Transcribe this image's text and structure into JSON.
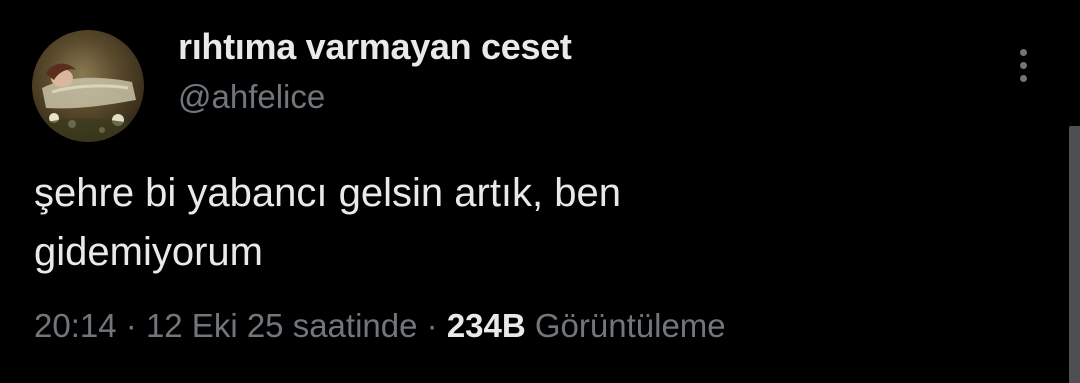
{
  "author": {
    "display_name": "rıhtıma varmayan ceset",
    "handle": "@ahfelice"
  },
  "tweet": {
    "text_line1": "şehre bi yabancı gelsin artık, ben",
    "text_line2": "gidemiyorum"
  },
  "meta": {
    "time": "20:14",
    "separator1": "·",
    "date": "12 Eki 25 saatinde",
    "separator2": "·",
    "views_count": "234B",
    "views_label": "Görüntüleme"
  },
  "icons": {
    "more": "more-vertical-icon",
    "avatar": "avatar-painting"
  },
  "colors": {
    "background": "#000000",
    "primary_text": "#e7e9ea",
    "secondary_text": "#71767b"
  }
}
